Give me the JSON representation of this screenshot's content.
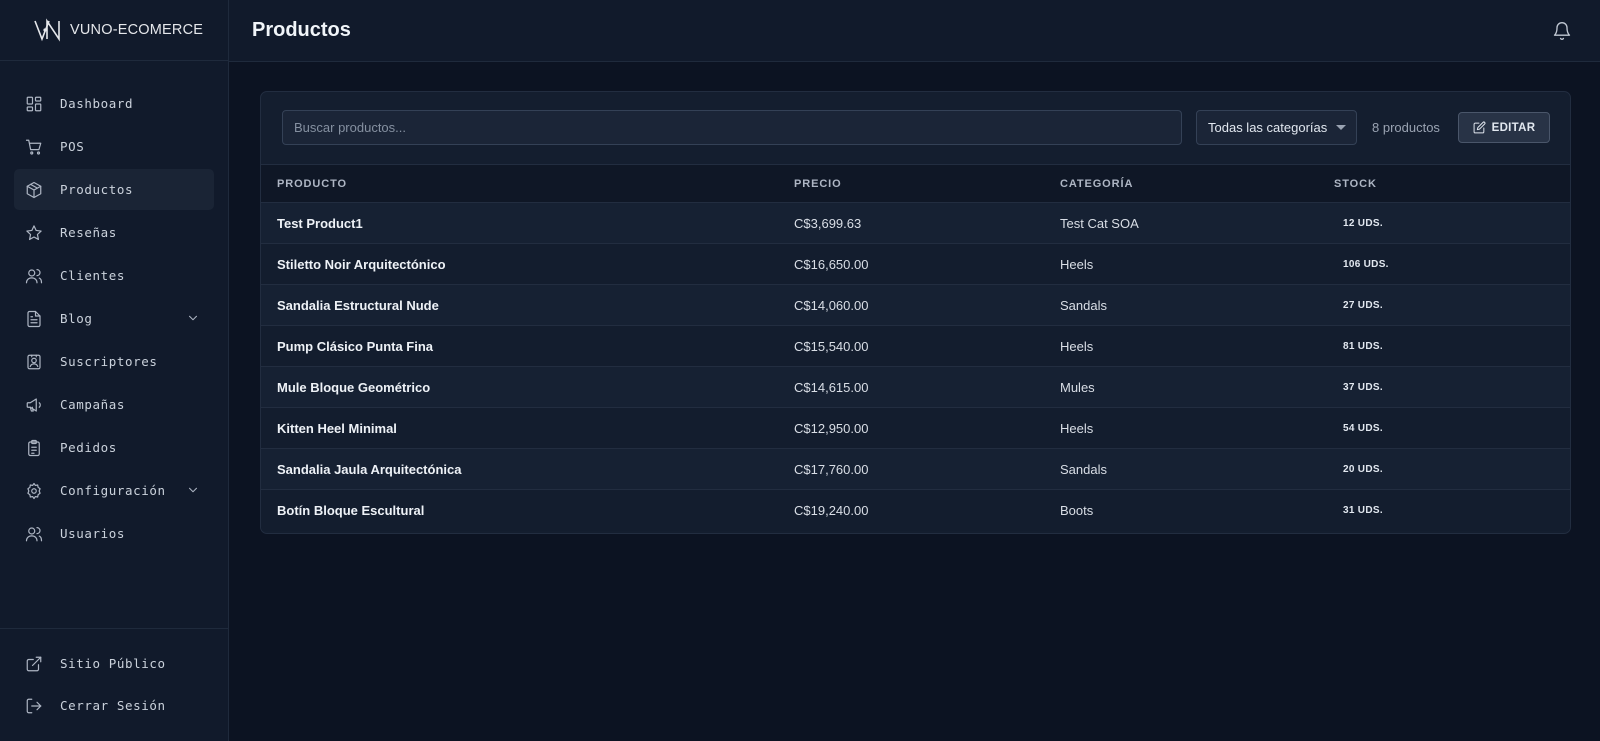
{
  "brand": {
    "name_part1": "VUNO",
    "name_part2": "-ECOMERCE"
  },
  "sidebar": {
    "items": [
      {
        "label": "Dashboard",
        "icon": "dashboard-icon",
        "active": false
      },
      {
        "label": "POS",
        "icon": "cart-icon",
        "active": false
      },
      {
        "label": "Productos",
        "icon": "box-icon",
        "active": true
      },
      {
        "label": "Reseñas",
        "icon": "star-icon",
        "active": false
      },
      {
        "label": "Clientes",
        "icon": "users-icon",
        "active": false
      },
      {
        "label": "Blog",
        "icon": "file-icon",
        "active": false,
        "expandable": true
      },
      {
        "label": "Suscriptores",
        "icon": "contact-icon",
        "active": false
      },
      {
        "label": "Campañas",
        "icon": "megaphone-icon",
        "active": false
      },
      {
        "label": "Pedidos",
        "icon": "clipboard-icon",
        "active": false
      },
      {
        "label": "Configuración",
        "icon": "gear-icon",
        "active": false,
        "expandable": true
      },
      {
        "label": "Usuarios",
        "icon": "users-icon",
        "active": false
      }
    ],
    "bottom": [
      {
        "label": "Sitio Público",
        "icon": "external-link-icon"
      },
      {
        "label": "Cerrar Sesión",
        "icon": "logout-icon"
      }
    ]
  },
  "header": {
    "title": "Productos"
  },
  "toolbar": {
    "search_placeholder": "Buscar productos...",
    "search_value": "",
    "category_selected": "Todas las categorías",
    "count_text": "8 productos",
    "edit_label": "EDITAR"
  },
  "table": {
    "columns": [
      "PRODUCTO",
      "PRECIO",
      "CATEGORÍA",
      "STOCK"
    ],
    "rows": [
      {
        "name": "Test Product1",
        "price": "C$3,699.63",
        "category": "Test Cat SOA",
        "stock": "12 UDS."
      },
      {
        "name": "Stiletto Noir Arquitectónico",
        "price": "C$16,650.00",
        "category": "Heels",
        "stock": "106 UDS."
      },
      {
        "name": "Sandalia Estructural Nude",
        "price": "C$14,060.00",
        "category": "Sandals",
        "stock": "27 UDS."
      },
      {
        "name": "Pump Clásico Punta Fina",
        "price": "C$15,540.00",
        "category": "Heels",
        "stock": "81 UDS."
      },
      {
        "name": "Mule Bloque Geométrico",
        "price": "C$14,615.00",
        "category": "Mules",
        "stock": "37 UDS."
      },
      {
        "name": "Kitten Heel Minimal",
        "price": "C$12,950.00",
        "category": "Heels",
        "stock": "54 UDS."
      },
      {
        "name": "Sandalia Jaula Arquitectónica",
        "price": "C$17,760.00",
        "category": "Sandals",
        "stock": "20 UDS."
      },
      {
        "name": "Botín Bloque Escultural",
        "price": "C$19,240.00",
        "category": "Boots",
        "stock": "31 UDS."
      }
    ]
  },
  "colors": {
    "background": "#0c1322",
    "sidebar": "#111a2b",
    "card": "#141e2f",
    "active_item": "#1a2435"
  }
}
